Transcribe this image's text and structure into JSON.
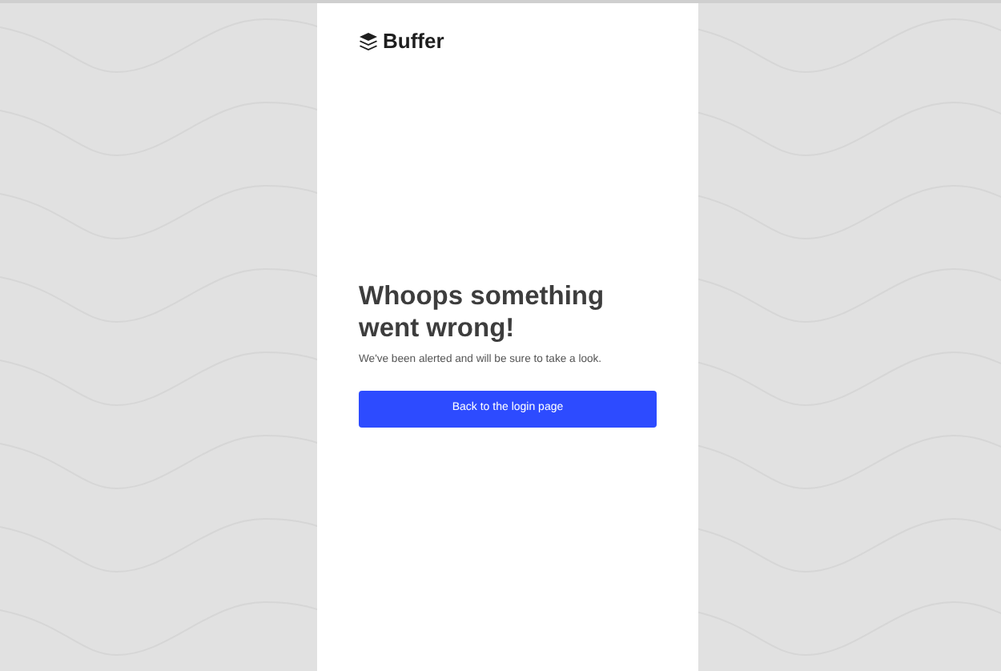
{
  "logo": {
    "text": "Buffer"
  },
  "error": {
    "title": "Whoops something went wrong!",
    "message": "We've been alerted and will be sure to take a look."
  },
  "button": {
    "label": "Back to the login page"
  }
}
